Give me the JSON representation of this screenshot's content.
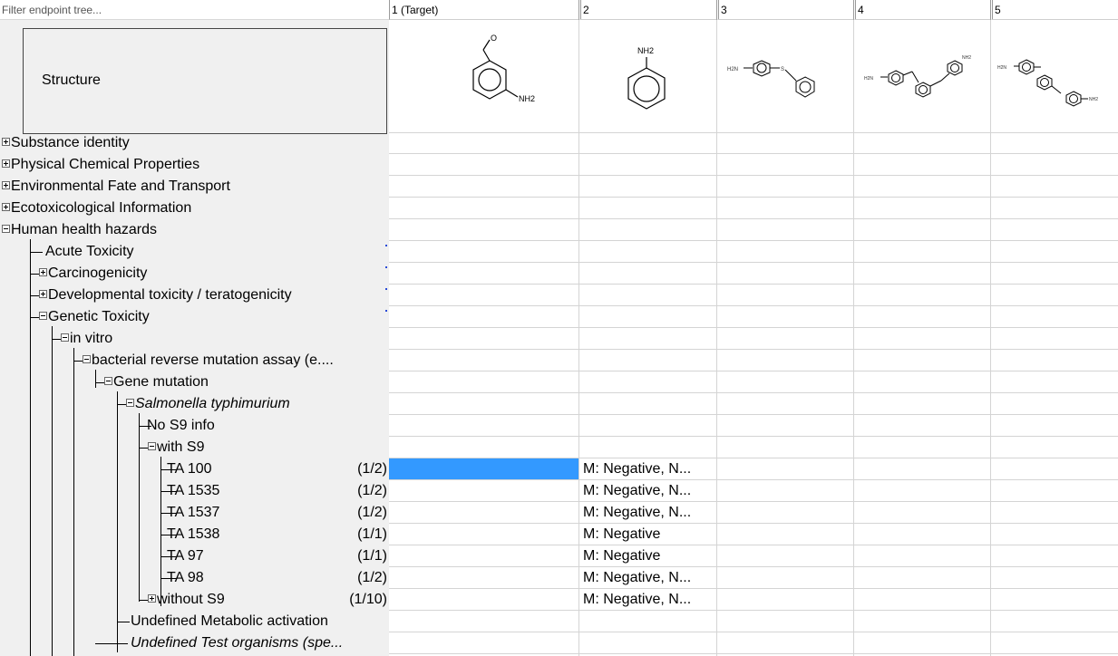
{
  "filter": {
    "placeholder": "Filter endpoint tree..."
  },
  "columns": [
    "1 (Target)",
    "2",
    "3",
    "4",
    "5"
  ],
  "structure_label": "Structure",
  "structures": {
    "c1": {
      "substituent_top": "O",
      "substituent_right": "NH2"
    },
    "c2": {
      "substituent_top": "NH2"
    },
    "c3": {
      "left": "H2N",
      "mid": "S"
    },
    "c4": {
      "left": "H2N",
      "right": "NH2"
    },
    "c5": {
      "left": "H2N",
      "right": "NH2"
    }
  },
  "tree": [
    {
      "label": "Substance identity",
      "count": ""
    },
    {
      "label": "Physical Chemical Properties",
      "count": ""
    },
    {
      "label": "Environmental Fate and Transport",
      "count": ""
    },
    {
      "label": "Ecotoxicological Information",
      "count": ""
    },
    {
      "label": "Human health hazards",
      "count": ""
    },
    {
      "label": "Acute Toxicity",
      "count": ""
    },
    {
      "label": "Carcinogenicity",
      "count": ""
    },
    {
      "label": "Developmental toxicity / teratogenicity",
      "count": ""
    },
    {
      "label": "Genetic Toxicity",
      "count": ""
    },
    {
      "label": "in vitro",
      "count": ""
    },
    {
      "label": "bacterial reverse mutation assay (e....",
      "count": ""
    },
    {
      "label": "Gene mutation",
      "count": ""
    },
    {
      "label": "Salmonella typhimurium",
      "count": ""
    },
    {
      "label": "No S9 info",
      "count": ""
    },
    {
      "label": "with S9",
      "count": ""
    },
    {
      "label": "TA 100",
      "count": "(1/2)"
    },
    {
      "label": "TA 1535",
      "count": "(1/2)"
    },
    {
      "label": "TA 1537",
      "count": "(1/2)"
    },
    {
      "label": "TA 1538",
      "count": "(1/1)"
    },
    {
      "label": "TA 97",
      "count": "(1/1)"
    },
    {
      "label": "TA 98",
      "count": "(1/2)"
    },
    {
      "label": "without S9",
      "count": "(1/10)"
    },
    {
      "label": "Undefined Metabolic activation",
      "count": ""
    },
    {
      "label": "Undefined Test organisms (spe...",
      "count": ""
    }
  ],
  "col2_values": {
    "r15": "M: Negative, N...",
    "r16": "M: Negative, N...",
    "r17": "M: Negative, N...",
    "r18": "M: Negative",
    "r19": "M: Negative",
    "r20": "M: Negative, N...",
    "r21": "M: Negative, N..."
  },
  "colors": {
    "selection": "#3399ff",
    "tree_bg": "#f0f0f0",
    "grid": "#d4d4d4"
  }
}
